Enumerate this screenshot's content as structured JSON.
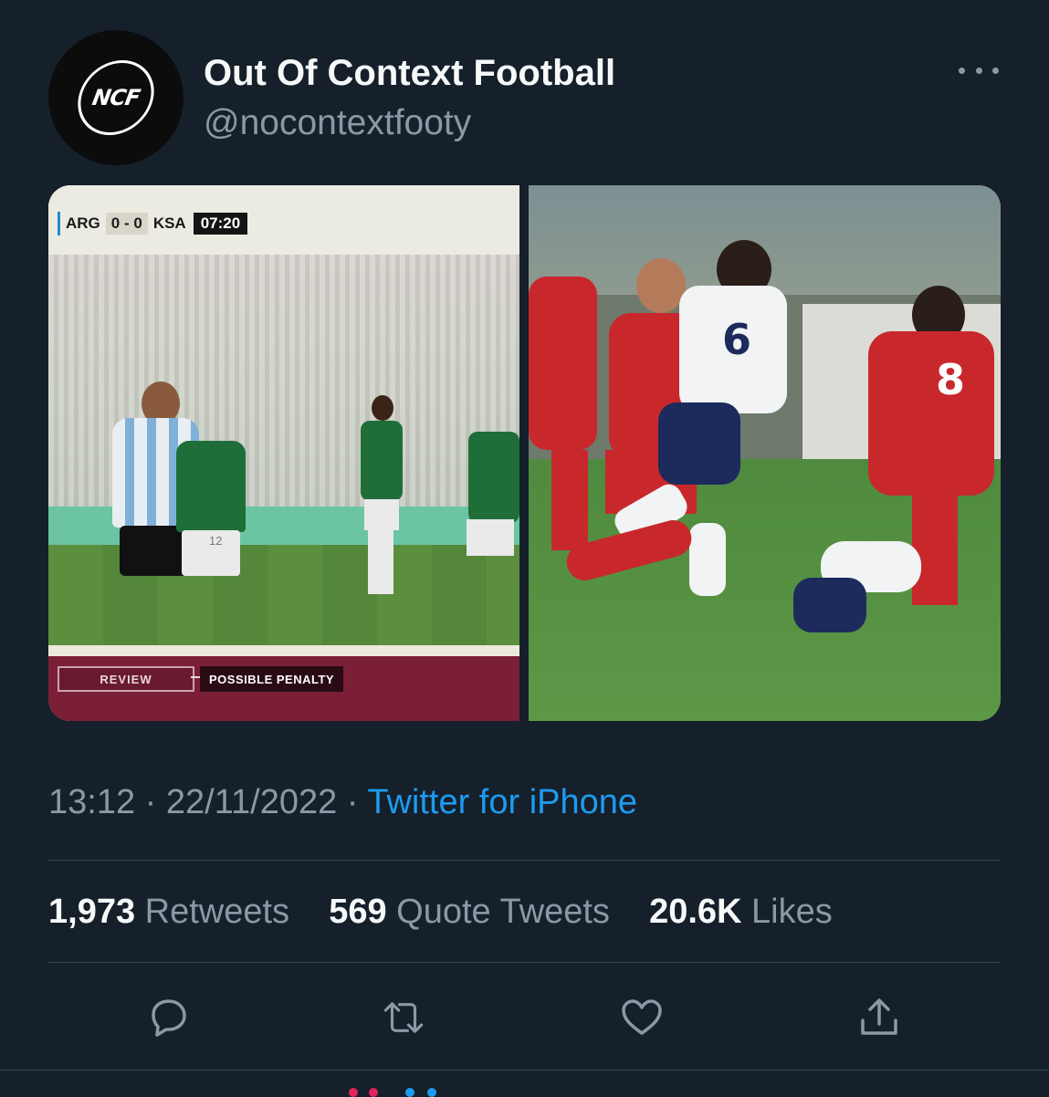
{
  "tweet": {
    "author_name": "Out Of Context Football",
    "author_handle": "@nocontextfooty",
    "avatar_text": "NCF",
    "time": "13:12",
    "date": "22/11/2022",
    "separator": " · ",
    "source": "Twitter for iPhone"
  },
  "media": {
    "left": {
      "home_team": "ARG",
      "score": "0 - 0",
      "away_team": "KSA",
      "match_clock": "07:20",
      "review_label": "REVIEW",
      "review_reason": "POSSIBLE PENALTY",
      "shirt_number": "12"
    },
    "right": {
      "shirt_number_white": "6",
      "shirt_number_red": "8"
    }
  },
  "stats": {
    "retweets_count": "1,973",
    "retweets_label": "Retweets",
    "quotes_count": "569",
    "quotes_label": "Quote Tweets",
    "likes_count": "20.6K",
    "likes_label": "Likes"
  },
  "actions": [
    "reply-icon",
    "retweet-icon",
    "like-icon",
    "share-icon"
  ],
  "colors": {
    "background": "#15202b",
    "primary_text": "#f7f9f9",
    "secondary_text": "#8b98a5",
    "link": "#1d9bf0",
    "divider": "#38444d"
  }
}
